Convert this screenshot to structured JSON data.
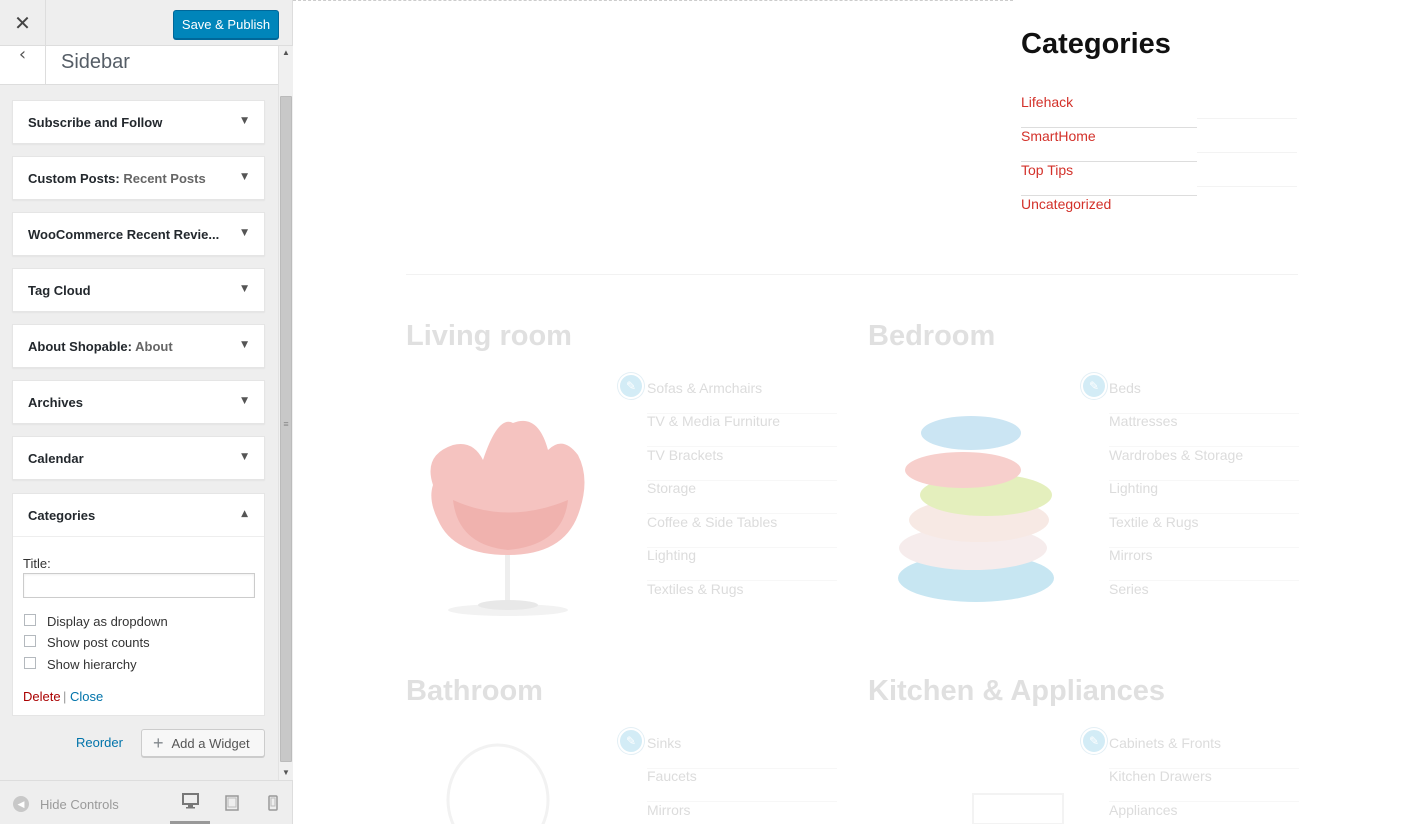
{
  "header": {
    "close_glyph": "✕",
    "save_label": "Save & Publish"
  },
  "section": {
    "back_glyph": "‹",
    "title": "Sidebar"
  },
  "widgets": [
    {
      "title": "Subscribe and Follow",
      "sub": ""
    },
    {
      "title": "Custom Posts:",
      "sub": " Recent Posts"
    },
    {
      "title": "WooCommerce Recent Revie...",
      "sub": ""
    },
    {
      "title": "Tag Cloud",
      "sub": ""
    },
    {
      "title": "About Shopable:",
      "sub": " About"
    },
    {
      "title": "Archives",
      "sub": ""
    },
    {
      "title": "Calendar",
      "sub": ""
    }
  ],
  "expanded_widget": {
    "title": "Categories",
    "title_label": "Title:",
    "title_value": "",
    "options": [
      {
        "label": "Display as dropdown",
        "checked": false
      },
      {
        "label": "Show post counts",
        "checked": false
      },
      {
        "label": "Show hierarchy",
        "checked": false
      }
    ],
    "delete_label": "Delete",
    "separator": "|",
    "close_label": "Close"
  },
  "actions": {
    "reorder_label": "Reorder",
    "add_widget_label": "Add a Widget",
    "add_icon": "+"
  },
  "footer": {
    "hide_controls_label": "Hide Controls"
  },
  "preview": {
    "widget_title": "Categories",
    "categories": [
      "Lifehack",
      "SmartHome",
      "Top Tips",
      "Uncategorized"
    ],
    "rooms": [
      {
        "title": "Living room",
        "links": [
          "Sofas & Armchairs",
          "TV & Media Furniture",
          "TV Brackets",
          "Storage",
          "Coffee & Side Tables",
          "Lighting",
          "Textiles & Rugs"
        ]
      },
      {
        "title": "Bedroom",
        "links": [
          "Beds",
          "Mattresses",
          "Wardrobes & Storage",
          "Lighting",
          "Textile & Rugs",
          "Mirrors",
          "Series"
        ]
      },
      {
        "title": "Bathroom",
        "links": [
          "Sinks",
          "Faucets",
          "Mirrors"
        ]
      },
      {
        "title": "Kitchen & Appliances",
        "links": [
          "Cabinets & Fronts",
          "Kitchen Drawers",
          "Appliances"
        ]
      }
    ]
  },
  "colors": {
    "primary_button": "#0085ba",
    "link": "#0073aa",
    "delete": "#a00000",
    "category_link": "#d3312a"
  }
}
